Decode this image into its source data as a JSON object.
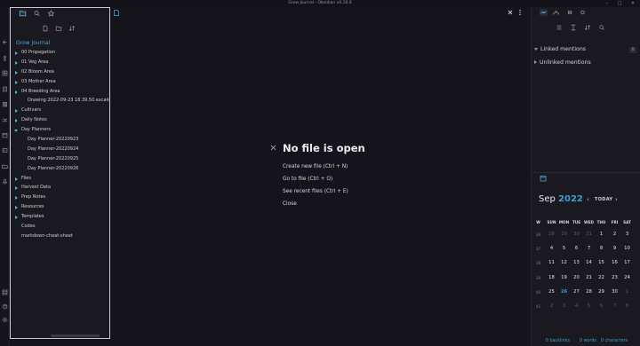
{
  "window": {
    "title": "Grow Journal - Obsidian v0.16.0",
    "controls": [
      "–",
      "□",
      "✕"
    ]
  },
  "ribbon": {
    "icons": [
      "collapse-icon",
      "graph-icon",
      "canvas-icon",
      "daily-note-icon",
      "template-icon",
      "random-icon",
      "calendar-icon",
      "command-icon",
      "folder-open-icon",
      "audio-icon",
      "vault-icon",
      "help-icon",
      "settings-icon"
    ]
  },
  "left_panel": {
    "tabs": [
      "folder-icon",
      "search-icon",
      "star-icon"
    ],
    "toolbar": [
      "new-note-icon",
      "new-folder-icon",
      "sort-icon"
    ],
    "vault_name": "Grow Journal",
    "tree": [
      {
        "label": "00 Propagation",
        "type": "folder",
        "open": false,
        "depth": 0
      },
      {
        "label": "01 Veg Area",
        "type": "folder",
        "open": false,
        "depth": 0
      },
      {
        "label": "02 Bloom Area",
        "type": "folder",
        "open": false,
        "depth": 0
      },
      {
        "label": "03 Mother Area",
        "type": "folder",
        "open": false,
        "depth": 0
      },
      {
        "label": "04 Breeding Area",
        "type": "folder",
        "open": false,
        "depth": 0
      },
      {
        "label": "Drawing 2022-09-23 18.39.50.excalidraw",
        "type": "file",
        "depth": 1
      },
      {
        "label": "Cultivars",
        "type": "folder",
        "open": false,
        "depth": 0
      },
      {
        "label": "Daily Notes",
        "type": "folder",
        "open": false,
        "depth": 0
      },
      {
        "label": "Day Planners",
        "type": "folder",
        "open": true,
        "depth": 0
      },
      {
        "label": "Day Planner-20220923",
        "type": "file",
        "depth": 1
      },
      {
        "label": "Day Planner-20220924",
        "type": "file",
        "depth": 1
      },
      {
        "label": "Day Planner-20220925",
        "type": "file",
        "depth": 1
      },
      {
        "label": "Day Planner-20220926",
        "type": "file",
        "depth": 1
      },
      {
        "label": "Files",
        "type": "folder",
        "open": false,
        "depth": 0
      },
      {
        "label": "Harvest Data",
        "type": "folder",
        "open": false,
        "depth": 0
      },
      {
        "label": "Prep Notes",
        "type": "folder",
        "open": false,
        "depth": 0
      },
      {
        "label": "Resources",
        "type": "folder",
        "open": false,
        "depth": 0
      },
      {
        "label": "Templates",
        "type": "folder",
        "open": false,
        "depth": 0
      },
      {
        "label": "Codex",
        "type": "file",
        "depth": 0
      },
      {
        "label": "markdown-cheat-sheet",
        "type": "file",
        "depth": 0
      }
    ]
  },
  "main": {
    "empty_title": "No file is open",
    "actions": [
      "Create new file (Ctrl + N)",
      "Go to file (Ctrl + O)",
      "See recent files (Ctrl + E)",
      "Close"
    ]
  },
  "right_panel": {
    "tabs": [
      "backlinks-icon",
      "outgoing-links-icon",
      "tags-icon",
      "outline-icon"
    ],
    "toolbar": [
      "collapse-results-icon",
      "show-context-icon",
      "sort-icon",
      "search-icon"
    ],
    "linked_mentions": "Linked mentions",
    "linked_count": "0",
    "unlinked_mentions": "Unlinked mentions"
  },
  "calendar": {
    "month": "Sep",
    "year": "2022",
    "today_label": "TODAY",
    "prev": "‹",
    "next": "›",
    "headers": [
      "W",
      "SUN",
      "MON",
      "TUE",
      "WED",
      "THU",
      "FRI",
      "SAT"
    ],
    "today_day": "26",
    "rows": [
      {
        "week": "36",
        "days": [
          "28",
          "29",
          "30",
          "31",
          "1",
          "2",
          "3"
        ],
        "dim": [
          true,
          true,
          true,
          true,
          false,
          false,
          false
        ]
      },
      {
        "week": "37",
        "days": [
          "4",
          "5",
          "6",
          "7",
          "8",
          "9",
          "10"
        ],
        "dim": [
          false,
          false,
          false,
          false,
          false,
          false,
          false
        ]
      },
      {
        "week": "38",
        "days": [
          "11",
          "12",
          "13",
          "14",
          "15",
          "16",
          "17"
        ],
        "dim": [
          false,
          false,
          false,
          false,
          false,
          false,
          false
        ]
      },
      {
        "week": "39",
        "days": [
          "18",
          "19",
          "20",
          "21",
          "22",
          "23",
          "24"
        ],
        "dim": [
          false,
          false,
          false,
          false,
          false,
          false,
          false
        ]
      },
      {
        "week": "40",
        "days": [
          "25",
          "26",
          "27",
          "28",
          "29",
          "30",
          "1"
        ],
        "dim": [
          false,
          false,
          false,
          false,
          false,
          false,
          true
        ]
      },
      {
        "week": "41",
        "days": [
          "2",
          "3",
          "4",
          "5",
          "6",
          "7",
          "8"
        ],
        "dim": [
          true,
          true,
          true,
          true,
          true,
          true,
          true
        ]
      }
    ]
  },
  "status": {
    "backlinks": "0 backlinks",
    "words": "0 words",
    "characters": "0 characters"
  },
  "colors": {
    "accent": "#3aa0d0",
    "background": "#15141b",
    "panel": "#1a1920"
  }
}
